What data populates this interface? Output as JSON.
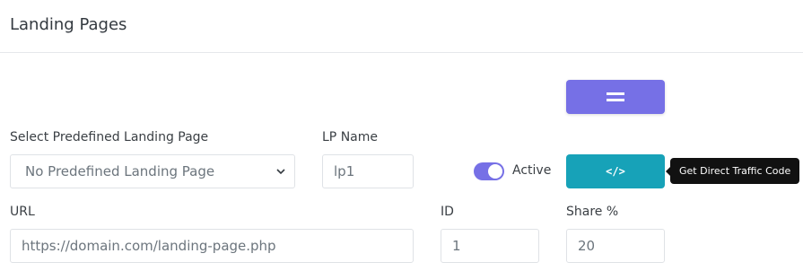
{
  "header": {
    "title": "Landing Pages"
  },
  "form": {
    "predefined": {
      "label": "Select Predefined Landing Page",
      "value": "No Predefined Landing Page"
    },
    "lp_name": {
      "label": "LP Name",
      "value": "lp1"
    },
    "active": {
      "label": "Active",
      "on": true
    },
    "url": {
      "label": "URL",
      "placeholder": "https://domain.com/landing-page.php"
    },
    "id": {
      "label": "ID",
      "value": "1"
    },
    "share": {
      "label": "Share %",
      "value": "20"
    }
  },
  "buttons": {
    "drag_icon": "drag-handle-icon",
    "code_icon": "code-icon",
    "code_symbol": "</>",
    "tooltip": "Get Direct Traffic Code"
  },
  "colors": {
    "accent": "#7670e6",
    "info": "#17a2b8",
    "tooltip_bg": "#111111"
  }
}
